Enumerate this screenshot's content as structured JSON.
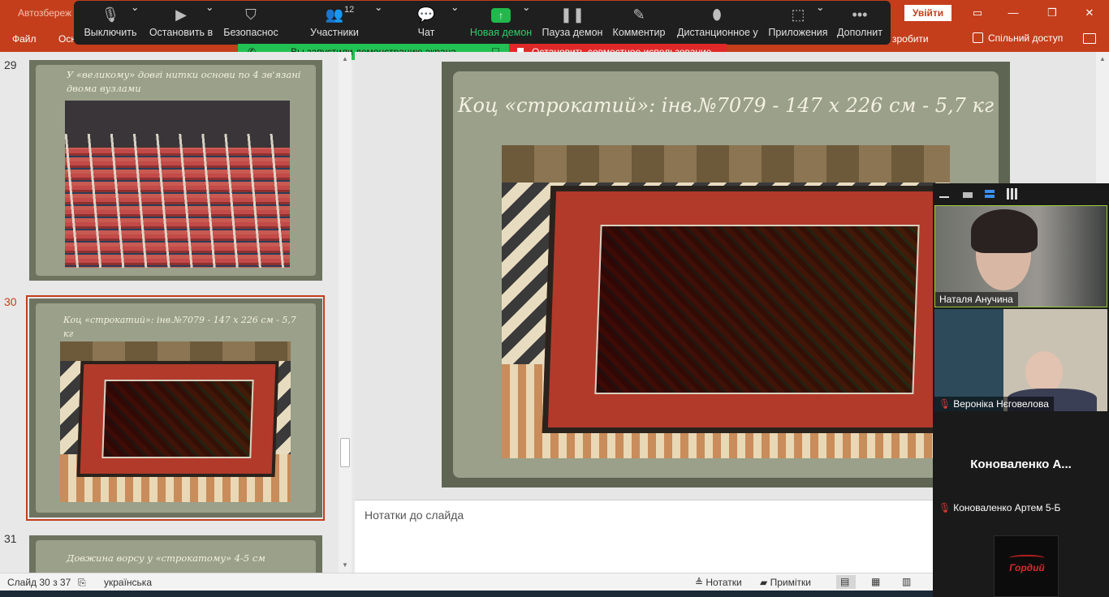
{
  "ppt": {
    "autosave": "Автозбереж",
    "login": "Увійти",
    "ribbon": [
      "Файл",
      "Осн"
    ],
    "ribbon_tail": "зробити",
    "share": "Спільний доступ"
  },
  "zoom_toolbar": {
    "mute": "Выключить",
    "stop_video": "Остановить в",
    "security": "Безопаснос",
    "participants": "Участники",
    "participants_count": "12",
    "chat": "Чат",
    "new_share": "Новая демон",
    "pause_share": "Пауза демон",
    "annotate": "Комментир",
    "remote": "Дистанционное у",
    "apps": "Приложения",
    "more": "Дополнит"
  },
  "banners": {
    "sharing": "Вы запустили демонстрацию экрана",
    "stop": "Остановить совместное использование"
  },
  "thumbnails": [
    {
      "num": "29",
      "title": "У «великому»  довгі нитки основи по 4 зв'язані двома вузлами"
    },
    {
      "num": "30",
      "title": "Коц «строкатий»: інв.№7079 - 147 х 226 см - 5,7 кг"
    },
    {
      "num": "31",
      "title": "Довжина ворсу  у «строкатому»  4-5 см"
    }
  ],
  "main_slide": {
    "title": "Коц «строкатий»: інв.№7079 - 147 х 226 см - 5,7 кг"
  },
  "notes": {
    "placeholder": "Нотатки до слайда"
  },
  "status": {
    "slide": "Слайд 30 з 37",
    "language": "українська",
    "notes_btn": "Нотатки",
    "comments_btn": "Примітки"
  },
  "video": {
    "p1": "Наталя Анучина",
    "p2": "Вероніка Нєговелова",
    "p3_big": "Коноваленко  А...",
    "p3": "Коноваленко Артем 5-Б",
    "p4_avatar": "Гордий"
  },
  "colors": {
    "ppt_accent": "#c43e1c",
    "zoom_green": "#22c153",
    "zoom_red": "#e02828"
  }
}
